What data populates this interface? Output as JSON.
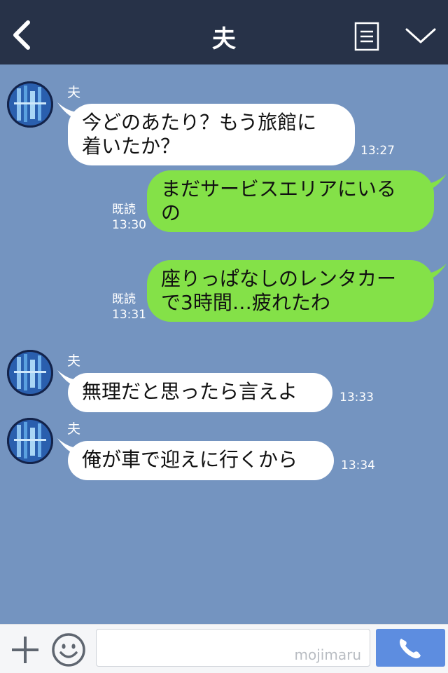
{
  "header": {
    "title": "夫",
    "back_icon": "back-chevron-icon",
    "note_icon": "note-icon",
    "menu_icon": "chevron-down-icon"
  },
  "messages": [
    {
      "side": "in",
      "sender": "夫",
      "text_lines": [
        "今どのあたり？もう旅館に",
        "着いたか？"
      ],
      "time": "13:27"
    },
    {
      "side": "out",
      "read": "既読",
      "time": "13:30",
      "text_lines": [
        "まだサービスエリアにいる",
        "の"
      ]
    },
    {
      "side": "out",
      "read": "既読",
      "time": "13:31",
      "text_lines": [
        "座りっぱなしのレンタカー",
        "で3時間…疲れたわ"
      ]
    },
    {
      "side": "in",
      "sender": "夫",
      "text_lines": [
        "無理だと思ったら言えよ"
      ],
      "time": "13:33"
    },
    {
      "side": "in",
      "sender": "夫",
      "text_lines": [
        "俺が車で迎えに行くから"
      ],
      "time": "13:34"
    }
  ],
  "input": {
    "watermark": "mojimaru"
  },
  "colors": {
    "header": "#273248",
    "background": "#7494c0",
    "bubble_in": "#ffffff",
    "bubble_out": "#84e148",
    "call_button": "#5d8de0"
  }
}
